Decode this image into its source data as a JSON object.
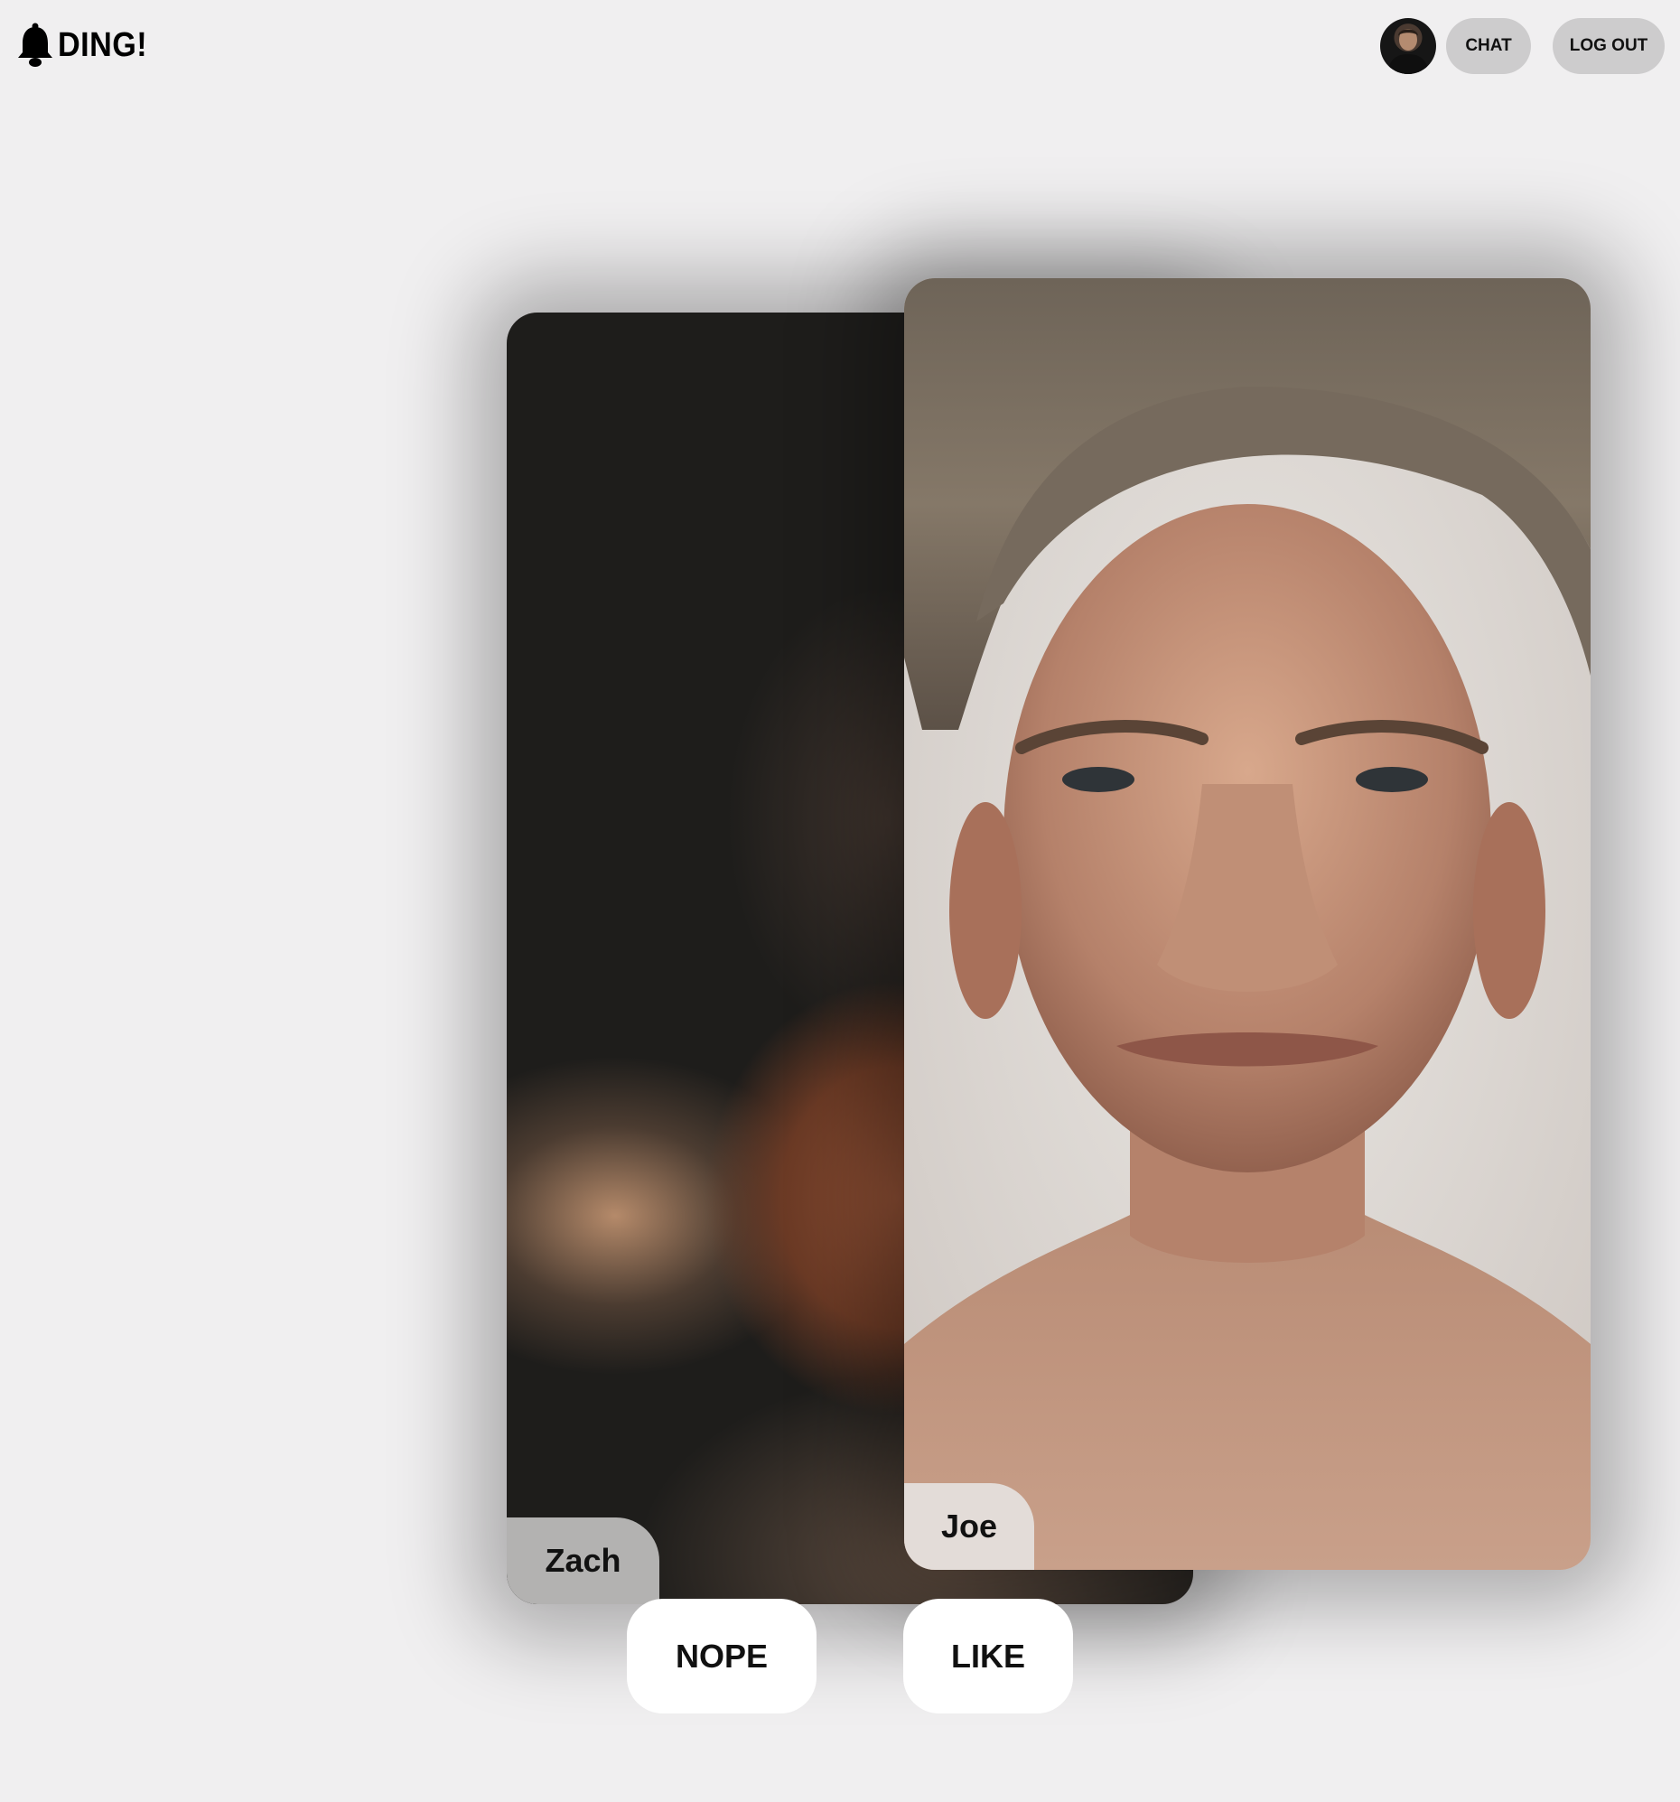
{
  "header": {
    "logo_text": "DING!",
    "logo_icon": "bell-icon",
    "chat_label": "CHAT",
    "logout_label": "LOG OUT"
  },
  "cards": [
    {
      "name": "Zach",
      "photo": "boxer-photo"
    },
    {
      "name": "Joe",
      "photo": "portrait-photo"
    }
  ],
  "actions": {
    "nope_label": "NOPE",
    "like_label": "LIKE"
  },
  "colors": {
    "background": "#f0eff0",
    "nav_button": "#cdcccd",
    "action_button": "#ffffff"
  }
}
